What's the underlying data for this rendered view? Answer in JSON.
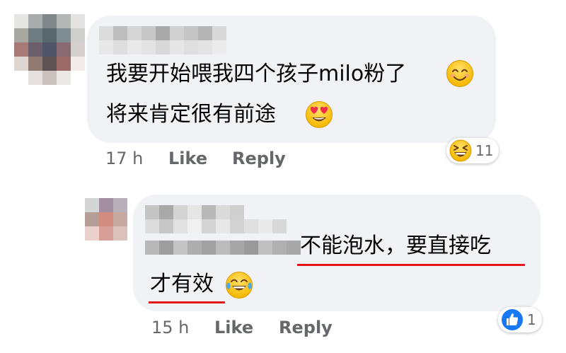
{
  "comments": [
    {
      "text_line1": "我要开始喂我四个孩子milo粉了",
      "text_line2": "将来肯定很有前途",
      "time": "17 h",
      "like_label": "Like",
      "reply_label": "Reply",
      "reaction": {
        "icon": "laughing-emoji-icon",
        "count": "11"
      },
      "line1_emoji": "smiling-emoji-icon",
      "line2_emoji": "heart-eyes-emoji-icon"
    },
    {
      "text_line1": "不能泡水，要直接吃",
      "text_line2": "才有效",
      "time": "15 h",
      "like_label": "Like",
      "reply_label": "Reply",
      "reaction": {
        "icon": "thumbs-up-like-icon",
        "count": "1"
      },
      "line2_emoji": "tears-of-joy-emoji-icon",
      "underline_color": "#e4151b"
    }
  ],
  "colors": {
    "bubble": "#f0f2f5",
    "meta_text": "#65676b",
    "like_blue": "#1877f2"
  }
}
